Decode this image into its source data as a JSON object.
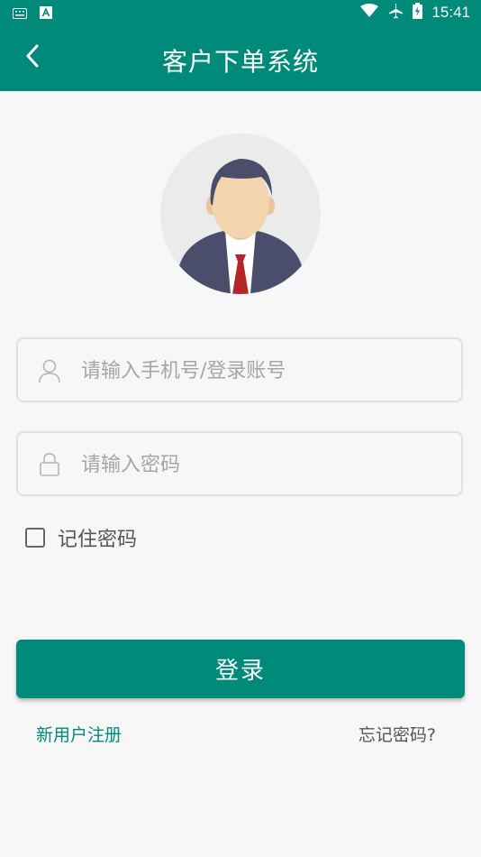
{
  "status_bar": {
    "time": "15:41"
  },
  "app_bar": {
    "title": "客户下单系统"
  },
  "login_form": {
    "account_placeholder": "请输入手机号/登录账号",
    "account_value": "",
    "password_placeholder": "请输入密码",
    "password_value": "",
    "remember_label": "记住密码",
    "remember_checked": false,
    "login_button": "登录",
    "register_link": "新用户注册",
    "forgot_link": "忘记密码?"
  },
  "colors": {
    "primary": "#008a7a",
    "background": "#f7f7f7",
    "placeholder": "#a5a5a5"
  }
}
